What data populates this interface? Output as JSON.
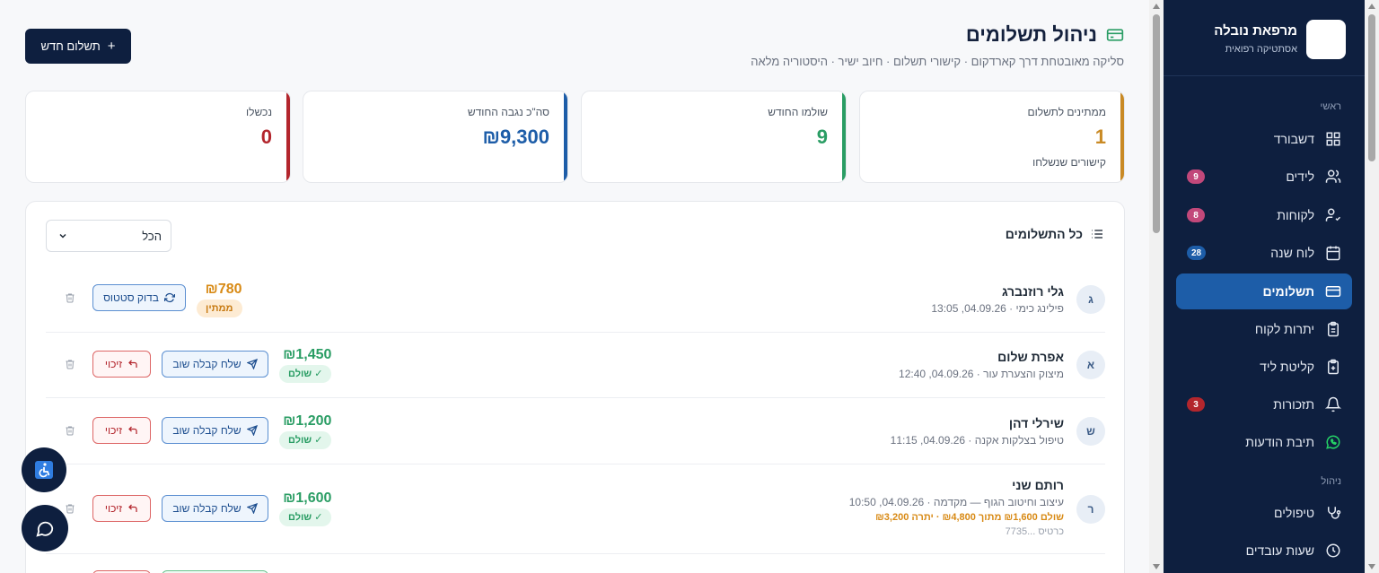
{
  "brand": {
    "name": "מרפאת נובלה",
    "subtitle": "אסתטיקה רפואית"
  },
  "sidebar": {
    "section_main": "ראשי",
    "section_manage": "ניהול",
    "items": [
      {
        "label": "דשבורד",
        "icon": "grid-icon",
        "badge": ""
      },
      {
        "label": "לידים",
        "icon": "users-icon",
        "badge": "9"
      },
      {
        "label": "לקוחות",
        "icon": "user-check-icon",
        "badge": "8"
      },
      {
        "label": "לוח שנה",
        "icon": "calendar-icon",
        "badge": "28"
      },
      {
        "label": "תשלומים",
        "icon": "credit-card-icon",
        "badge": ""
      },
      {
        "label": "יתרות לקוח",
        "icon": "clipboard-icon",
        "badge": ""
      },
      {
        "label": "קליטת ליד",
        "icon": "clipboard-plus-icon",
        "badge": ""
      },
      {
        "label": "תזכורות",
        "icon": "bell-icon",
        "badge": "3"
      },
      {
        "label": "תיבת הודעות",
        "icon": "whatsapp-icon",
        "badge": ""
      },
      {
        "label": "טיפולים",
        "icon": "stethoscope-icon",
        "badge": ""
      },
      {
        "label": "שעות עובדים",
        "icon": "clock-icon",
        "badge": ""
      }
    ]
  },
  "header": {
    "title": "ניהול תשלומים",
    "subtitle": "סליקה מאובטחת דרך קארדקום · קישורי תשלום · חיוב ישיר · היסטוריה מלאה",
    "new_payment": "תשלום חדש"
  },
  "stats": [
    {
      "label": "ממתינים לתשלום",
      "value": "1",
      "foot": "קישורים שנשלחו",
      "color": "#c98a25"
    },
    {
      "label": "שולמו החודש",
      "value": "9",
      "foot": "",
      "color": "#2a9d64"
    },
    {
      "label": "סה\"כ נגבה החודש",
      "value": "₪9,300",
      "foot": "",
      "color": "#1d5da8"
    },
    {
      "label": "נכשלו",
      "value": "0",
      "foot": "",
      "color": "#b3262d"
    }
  ],
  "panel": {
    "title": "כל התשלומים",
    "filter": "הכל"
  },
  "labels": {
    "check_status": "בדוק סטטוס",
    "resend_receipt": "שלח קבלה שוב",
    "refund": "זיכוי"
  },
  "payments": [
    {
      "initial": "ג",
      "name": "גלי רוזנברג",
      "meta": "פילינג כימי · 04.09.26, 13:05",
      "amount": "₪780",
      "status": "ממתין",
      "state": "pending",
      "extra": "",
      "card": ""
    },
    {
      "initial": "א",
      "name": "אפרת שלום",
      "meta": "מיצוק והצערת עור · 04.09.26, 12:40",
      "amount": "₪1,450",
      "status": "✓ שולם",
      "state": "paid",
      "extra": "",
      "card": ""
    },
    {
      "initial": "ש",
      "name": "שירלי דהן",
      "meta": "טיפול בצלקות אקנה · 04.09.26, 11:15",
      "amount": "₪1,200",
      "status": "✓ שולם",
      "state": "paid",
      "extra": "",
      "card": ""
    },
    {
      "initial": "ר",
      "name": "רותם שני",
      "meta": "עיצוב וחיטוב הגוף — מקדמה · 04.09.26, 10:50",
      "amount": "₪1,600",
      "status": "✓ שולם",
      "state": "paid",
      "extra": "שולם ₪1,600 מתוך ₪4,800 · יתרה ₪3,200",
      "card": "כרטיס ...7735"
    }
  ]
}
